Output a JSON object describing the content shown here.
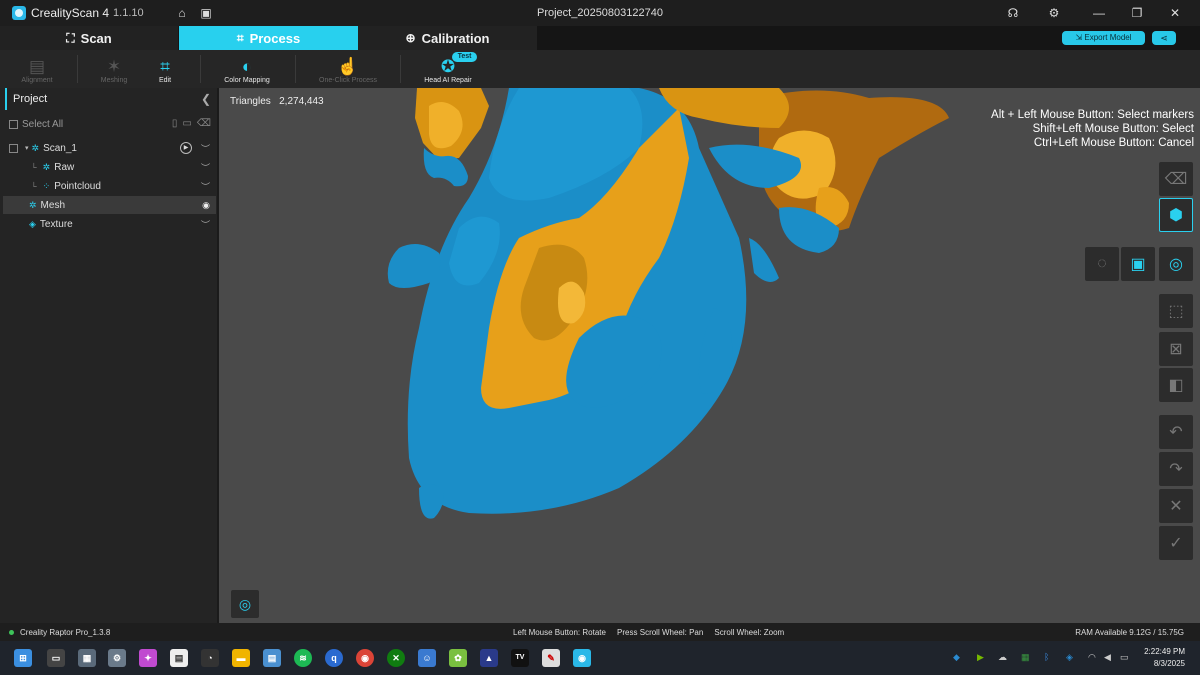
{
  "titlebar": {
    "app_name": "CrealityScan 4",
    "version": "1.1.10",
    "project_title": "Project_20250803122740"
  },
  "modes": [
    {
      "label": "Scan",
      "icon": "scan-icon",
      "active": false
    },
    {
      "label": "Process",
      "icon": "process-icon",
      "active": true
    },
    {
      "label": "Calibration",
      "icon": "crosshair-icon",
      "active": false
    }
  ],
  "header_actions": {
    "export_label": "Export Model"
  },
  "tools": [
    {
      "label": "Alignment",
      "enabled": false
    },
    {
      "label": "Meshing",
      "enabled": false
    },
    {
      "label": "Edit",
      "enabled": true
    },
    {
      "label": "Color Mapping",
      "enabled": true
    },
    {
      "label": "One-Click Process",
      "enabled": false
    },
    {
      "label": "Head AI Repair",
      "enabled": true,
      "badge": "Test"
    }
  ],
  "panel": {
    "title": "Project",
    "select_all": "Select All",
    "tree": [
      {
        "label": "Scan_1",
        "level": 0
      },
      {
        "label": "Raw",
        "level": 1
      },
      {
        "label": "Pointcloud",
        "level": 1
      },
      {
        "label": "Mesh",
        "level": 0,
        "selected": true
      },
      {
        "label": "Texture",
        "level": 0
      }
    ]
  },
  "viewport": {
    "triangles_label": "Triangles",
    "triangles_value": "2,274,443",
    "hints": [
      "Alt + Left Mouse Button: Select markers",
      "Shift+Left Mouse Button: Select",
      "Ctrl+Left Mouse Button: Cancel"
    ]
  },
  "status": {
    "device": "Creality Raptor Pro_1.3.8",
    "mouse_hints": "Left Mouse Button: Rotate     Press Scroll Wheel: Pan     Scroll Wheel: Zoom",
    "ram": "RAM Available 9.12G / 15.75G"
  },
  "clock": {
    "time": "2:22:49 PM",
    "date": "8/3/2025"
  },
  "colors": {
    "accent": "#28d0ee",
    "mesh_blue": "#1b8ec8",
    "mesh_gold": "#e8a21a",
    "viewport_bg": "#4a4a4a"
  }
}
